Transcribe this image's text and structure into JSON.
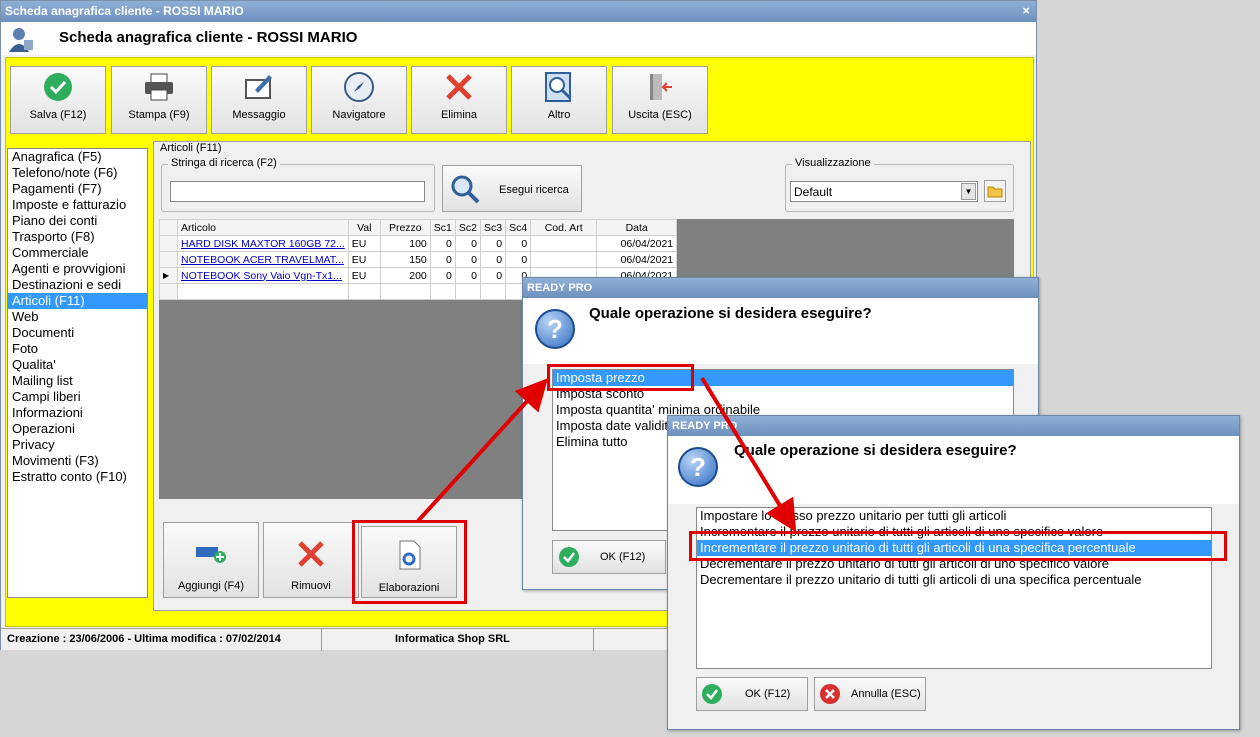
{
  "window": {
    "title_bar": "Scheda anagrafica cliente - ROSSI MARIO",
    "header_title": "Scheda anagrafica cliente - ROSSI MARIO",
    "close_glyph": "×"
  },
  "toolbar": [
    {
      "name": "salva",
      "label": "Salva (F12)",
      "icon": "check-icon"
    },
    {
      "name": "stampa",
      "label": "Stampa (F9)",
      "icon": "printer-icon"
    },
    {
      "name": "messaggio",
      "label": "Messaggio",
      "icon": "message-icon"
    },
    {
      "name": "navigatore",
      "label": "Navigatore",
      "icon": "compass-icon"
    },
    {
      "name": "elimina",
      "label": "Elimina",
      "icon": "delete-x-icon"
    },
    {
      "name": "altro",
      "label": "Altro",
      "icon": "search-book-icon"
    },
    {
      "name": "uscita",
      "label": "Uscita (ESC)",
      "icon": "exit-door-icon"
    }
  ],
  "sidebar": {
    "items": [
      "Anagrafica (F5)",
      "Telefono/note (F6)",
      "Pagamenti (F7)",
      "Imposte e fatturazio",
      "Piano dei conti",
      "Trasporto (F8)",
      "Commerciale",
      "Agenti e provvigioni",
      "Destinazioni e sedi",
      "Articoli (F11)",
      "Web",
      "Documenti",
      "Foto",
      "Qualita'",
      "Mailing list",
      "Campi liberi",
      "Informazioni",
      "Operazioni",
      "Privacy",
      "Movimenti (F3)",
      "Estratto conto (F10)"
    ],
    "selected_index": 9
  },
  "articoli": {
    "panel_caption": "Articoli (F11)",
    "search_caption": "Stringa di ricerca (F2)",
    "search_value": "",
    "search_button": "Esegui ricerca",
    "view_caption": "Visualizzazione",
    "view_value": "Default",
    "columns": [
      "Articolo",
      "Val",
      "Prezzo",
      "Sc1",
      "Sc2",
      "Sc3",
      "Sc4",
      "Cod. Art",
      "Data"
    ],
    "rows": [
      [
        "HARD DISK MAXTOR 160GB 72...",
        "EU",
        "100",
        "0",
        "0",
        "0",
        "0",
        "",
        "06/04/2021"
      ],
      [
        "NOTEBOOK ACER TRAVELMAT...",
        "EU",
        "150",
        "0",
        "0",
        "0",
        "0",
        "",
        "06/04/2021"
      ],
      [
        "NOTEBOOK Sony Vaio Vgn-Tx1...",
        "EU",
        "200",
        "0",
        "0",
        "0",
        "0",
        "",
        "06/04/2021"
      ]
    ],
    "current_row": 2,
    "buttons": [
      {
        "name": "aggiungi",
        "label": "Aggiungi (F4)"
      },
      {
        "name": "rimuovi",
        "label": "Rimuovi"
      },
      {
        "name": "elaborazioni",
        "label": "Elaborazioni"
      }
    ]
  },
  "status": {
    "left": "Creazione : 23/06/2006 - Ultima modifica : 07/02/2014",
    "center": "Informatica Shop SRL"
  },
  "dialog1": {
    "title": "READY PRO",
    "question": "Quale operazione si desidera eseguire?",
    "options": [
      "Imposta prezzo",
      "Imposta sconto",
      "Imposta quantita' minima ordinabile",
      "Imposta date validita'",
      "Elimina tutto"
    ],
    "selected_index": 0,
    "ok_label": "OK (F12)"
  },
  "dialog2": {
    "title": "READY PRO",
    "question": "Quale operazione si desidera eseguire?",
    "options": [
      "Impostare lo stesso prezzo unitario per tutti gli articoli",
      "Incrementare il prezzo unitario di tutti gli articoli di uno specifico valore",
      "Incrementare il prezzo unitario di tutti gli articoli di una specifica percentuale",
      "Decrementare il prezzo unitario di tutti gli articoli di uno specifico valore",
      "Decrementare il prezzo unitario di tutti gli articoli di una specifica percentuale"
    ],
    "selected_index": 2,
    "ok_label": "OK (F12)",
    "cancel_label": "Annulla (ESC)"
  },
  "colors": {
    "highlight_red": "#e00000",
    "panel_yellow": "#ffff00",
    "selection_blue": "#3399ff"
  }
}
